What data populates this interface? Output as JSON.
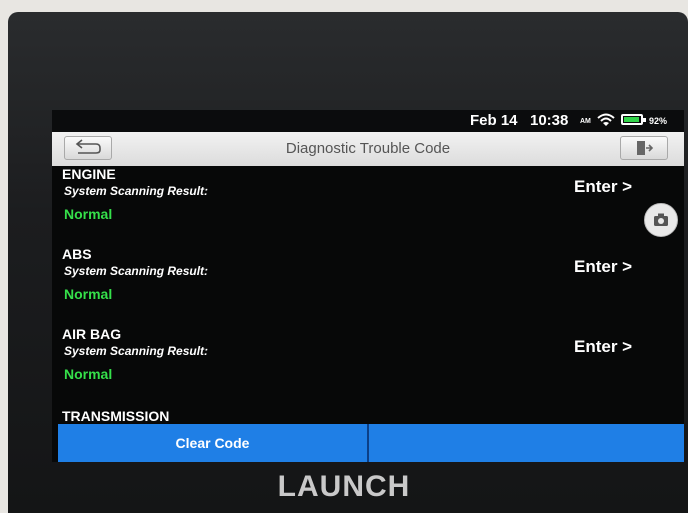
{
  "status_bar": {
    "date": "Feb 14",
    "time": "10:38",
    "ampm": "AM",
    "battery": "92%",
    "battery_level": 0.92
  },
  "header": {
    "title": "Diagnostic Trouble Code"
  },
  "systems": [
    {
      "name": "ENGINE",
      "label": "System Scanning Result:",
      "status": "Normal",
      "action": "Enter >"
    },
    {
      "name": "ABS",
      "label": "System Scanning Result:",
      "status": "Normal",
      "action": "Enter >"
    },
    {
      "name": "AIR BAG",
      "label": "System Scanning Result:",
      "status": "Normal",
      "action": "Enter >"
    },
    {
      "name": "TRANSMISSION"
    }
  ],
  "actions": {
    "clear_code": "Clear Code",
    "second": ""
  },
  "device": {
    "brand": "LAUNCH"
  },
  "icons": {
    "back": "back-arrow-icon",
    "exit": "exit-icon",
    "camera": "camera-icon",
    "wifi": "wifi-icon",
    "battery": "battery-icon"
  },
  "colors": {
    "status_ok": "#35e04a",
    "action_bar": "#1f7fe6",
    "background": "#070808"
  }
}
